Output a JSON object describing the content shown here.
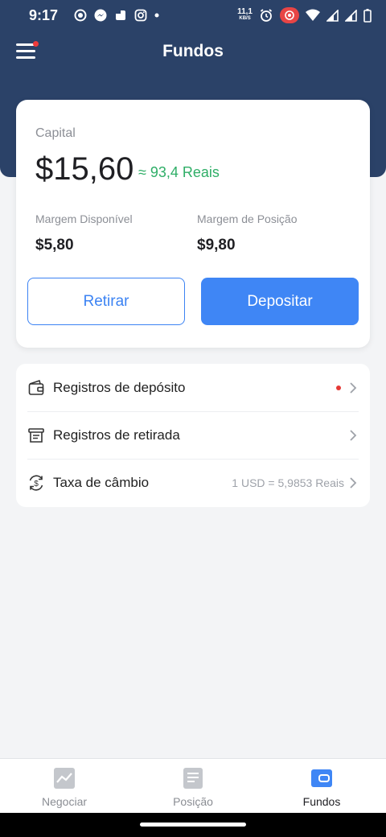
{
  "status_bar": {
    "time": "9:17",
    "net_speed": "11,1",
    "net_unit": "KB/S"
  },
  "header": {
    "title": "Fundos"
  },
  "capital": {
    "label": "Capital",
    "value": "$15,60",
    "approx": "≈ 93,4 Reais",
    "available_margin_label": "Margem Disponível",
    "available_margin_value": "$5,80",
    "position_margin_label": "Margem de Posição",
    "position_margin_value": "$9,80",
    "withdraw_label": "Retirar",
    "deposit_label": "Depositar"
  },
  "menu": {
    "deposit_records": "Registros de depósito",
    "withdraw_records": "Registros de retirada",
    "exchange_rate_label": "Taxa de câmbio",
    "exchange_rate_value": "1 USD = 5,9853 Reais"
  },
  "tabs": {
    "trade": "Negociar",
    "position": "Posição",
    "funds": "Fundos"
  },
  "colors": {
    "header_bg": "#2b4268",
    "accent": "#3f86f5",
    "positive": "#2fae67",
    "badge": "#e53935"
  }
}
